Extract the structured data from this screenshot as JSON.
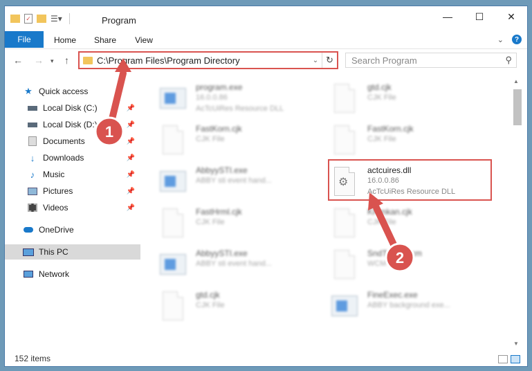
{
  "window": {
    "title": "Program",
    "controls": [
      "—",
      "☐",
      "✕"
    ]
  },
  "ribbon": {
    "tabs": [
      "File",
      "Home",
      "Share",
      "View"
    ]
  },
  "address": {
    "path": "C:\\Program Files\\Program Directory",
    "search_placeholder": "Search Program"
  },
  "sidebar": {
    "items": [
      {
        "label": "Quick access",
        "icon": "star-icon",
        "pinned": false
      },
      {
        "label": "Local Disk (C:)",
        "icon": "drive-icon",
        "pinned": true
      },
      {
        "label": "Local Disk (D:)",
        "icon": "drive-icon",
        "pinned": true
      },
      {
        "label": "Documents",
        "icon": "documents-icon",
        "pinned": true
      },
      {
        "label": "Downloads",
        "icon": "download-icon",
        "pinned": true
      },
      {
        "label": "Music",
        "icon": "music-icon",
        "pinned": true
      },
      {
        "label": "Pictures",
        "icon": "pictures-icon",
        "pinned": true
      },
      {
        "label": "Videos",
        "icon": "videos-icon",
        "pinned": true
      },
      {
        "label": "OneDrive",
        "icon": "cloud-icon",
        "pinned": false
      },
      {
        "label": "This PC",
        "icon": "computer-icon",
        "pinned": false
      },
      {
        "label": "Network",
        "icon": "network-icon",
        "pinned": false
      }
    ]
  },
  "files": [
    {
      "name": "program.exe",
      "line1": "16.0.0.86",
      "line2": "AcTcUiRes Resource DLL",
      "type": "app",
      "blurred": true
    },
    {
      "name": "gtd.cjk",
      "line1": "CJK File",
      "line2": "",
      "type": "doc",
      "blurred": true
    },
    {
      "name": "FastKorn.cjk",
      "line1": "CJK File",
      "line2": "",
      "type": "doc",
      "blurred": true
    },
    {
      "name": "FastKorn.cjk",
      "line1": "CJK File",
      "line2": "",
      "type": "doc",
      "blurred": true
    },
    {
      "name": "AbbyySTI.exe",
      "line1": "ABBY sti event hand...",
      "line2": "",
      "type": "app",
      "blurred": true
    },
    {
      "name": "actcuires.dll",
      "line1": "16.0.0.86",
      "line2": "AcTcUiRes Resource DLL",
      "type": "dll",
      "blurred": false
    },
    {
      "name": "FastHrml.cjk",
      "line1": "CJK File",
      "line2": "",
      "type": "doc",
      "blurred": true
    },
    {
      "name": "KHrnkan.cjk",
      "line1": "CJK File",
      "line2": "",
      "type": "doc",
      "blurred": true
    },
    {
      "name": "AbbyySTI.exe",
      "line1": "ABBY sti event hand...",
      "line2": "",
      "type": "app",
      "blurred": true
    },
    {
      "name": "SndTrack.wcm",
      "line1": "WCM File",
      "line2": "",
      "type": "doc",
      "blurred": true
    },
    {
      "name": "gtd.cjk",
      "line1": "CJK File",
      "line2": "",
      "type": "doc",
      "blurred": true
    },
    {
      "name": "FineExec.exe",
      "line1": "ABBY background exe...",
      "line2": "",
      "type": "app",
      "blurred": true
    }
  ],
  "status": {
    "count": "152 items"
  },
  "annotations": [
    {
      "label": "1"
    },
    {
      "label": "2"
    }
  ],
  "colors": {
    "accent": "#1979ca",
    "highlight": "#d9534f"
  }
}
